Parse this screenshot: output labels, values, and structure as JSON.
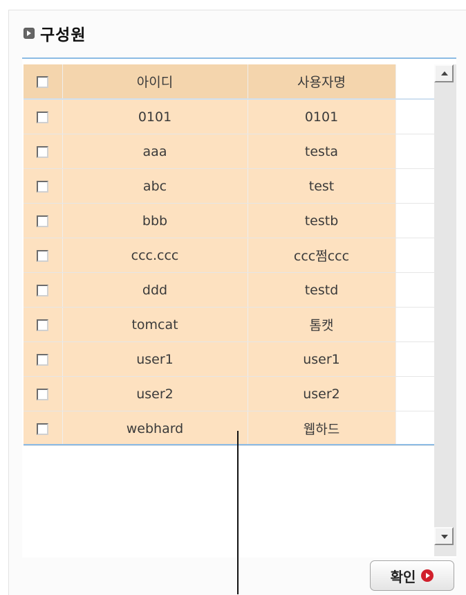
{
  "title": "구성원",
  "columns": {
    "id": "아이디",
    "name": "사용자명"
  },
  "rows": [
    {
      "id": "0101",
      "name": "0101"
    },
    {
      "id": "aaa",
      "name": "testa"
    },
    {
      "id": "abc",
      "name": "test"
    },
    {
      "id": "bbb",
      "name": "testb"
    },
    {
      "id": "ccc.ccc",
      "name": "ccc쩜ccc"
    },
    {
      "id": "ddd",
      "name": "testd"
    },
    {
      "id": "tomcat",
      "name": "톰캣"
    },
    {
      "id": "user1",
      "name": "user1"
    },
    {
      "id": "user2",
      "name": "user2"
    },
    {
      "id": "webhard",
      "name": "웹하드"
    }
  ],
  "confirm_label": "확인",
  "icons": {
    "title": "play-square-icon",
    "confirm": "red-arrow-circle-icon",
    "scroll_up": "triangle-up-icon",
    "scroll_down": "triangle-down-icon"
  },
  "colors": {
    "row_highlight": "#fde1c0",
    "header": "#f4d5ad",
    "border": "#8cbbe4",
    "confirm_icon": "#d1202c"
  }
}
